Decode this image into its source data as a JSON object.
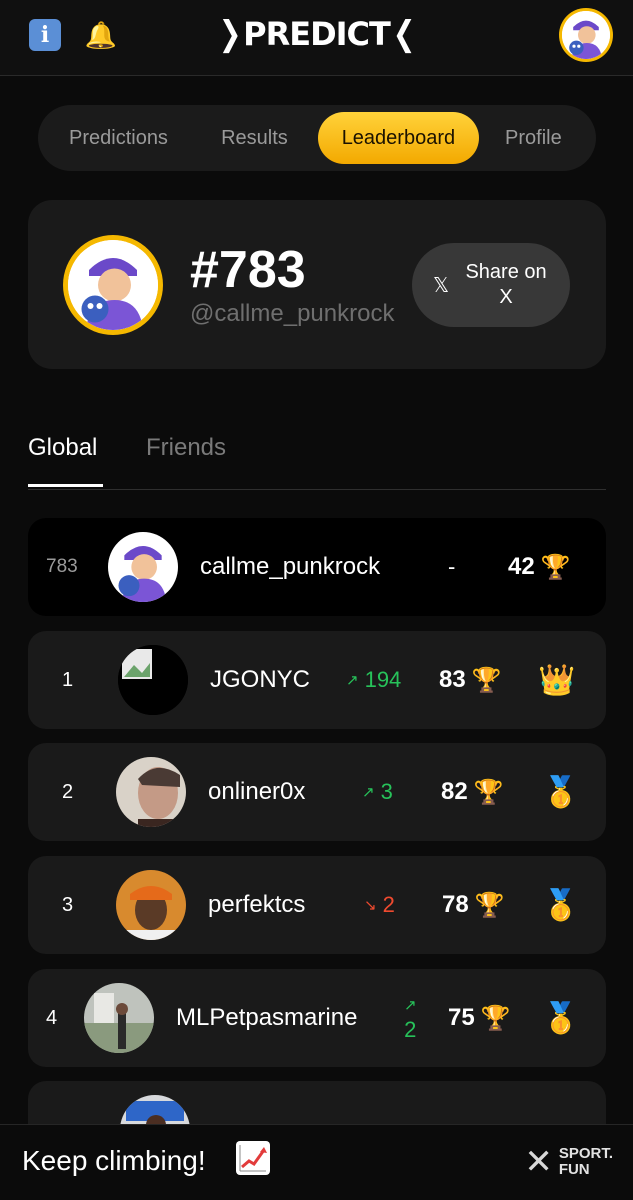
{
  "header": {
    "brand": "PREDICT",
    "info_icon": "info-icon",
    "bell_icon": "bell-icon"
  },
  "nav": {
    "tabs": [
      {
        "label": "Predictions",
        "active": false
      },
      {
        "label": "Results",
        "active": false
      },
      {
        "label": "Leaderboard",
        "active": true
      },
      {
        "label": "Profile",
        "active": false
      }
    ],
    "accent": "#f5b800"
  },
  "profile": {
    "rank": "#783",
    "handle": "@callme_punkrock",
    "share_label": "Share on X",
    "x_glyph": "𝕏"
  },
  "leader_tabs": {
    "global": "Global",
    "friends": "Friends",
    "active": "Global"
  },
  "rows": [
    {
      "rank": "783",
      "name": "callme_punkrock",
      "change": "-",
      "direction": "none",
      "score": "42",
      "medal": ""
    },
    {
      "rank": "1",
      "name": "JGONYC",
      "change": "194",
      "direction": "up",
      "score": "83",
      "medal": "👑"
    },
    {
      "rank": "2",
      "name": "onliner0x",
      "change": "3",
      "direction": "up",
      "score": "82",
      "medal": "🥇"
    },
    {
      "rank": "3",
      "name": "perfektcs",
      "change": "2",
      "direction": "down",
      "score": "78",
      "medal": "🥇"
    },
    {
      "rank": "4",
      "name": "MLPetpasmarine",
      "change": "2",
      "direction": "up",
      "score": "75",
      "medal": "🥇"
    }
  ],
  "footer": {
    "text": "Keep climbing!",
    "logo_line1": "SPORT.",
    "logo_line2": "FUN"
  },
  "colors": {
    "background": "#0b0b0b",
    "card": "#1a1a1a",
    "up": "#27c25a",
    "down": "#ef4a2f"
  }
}
